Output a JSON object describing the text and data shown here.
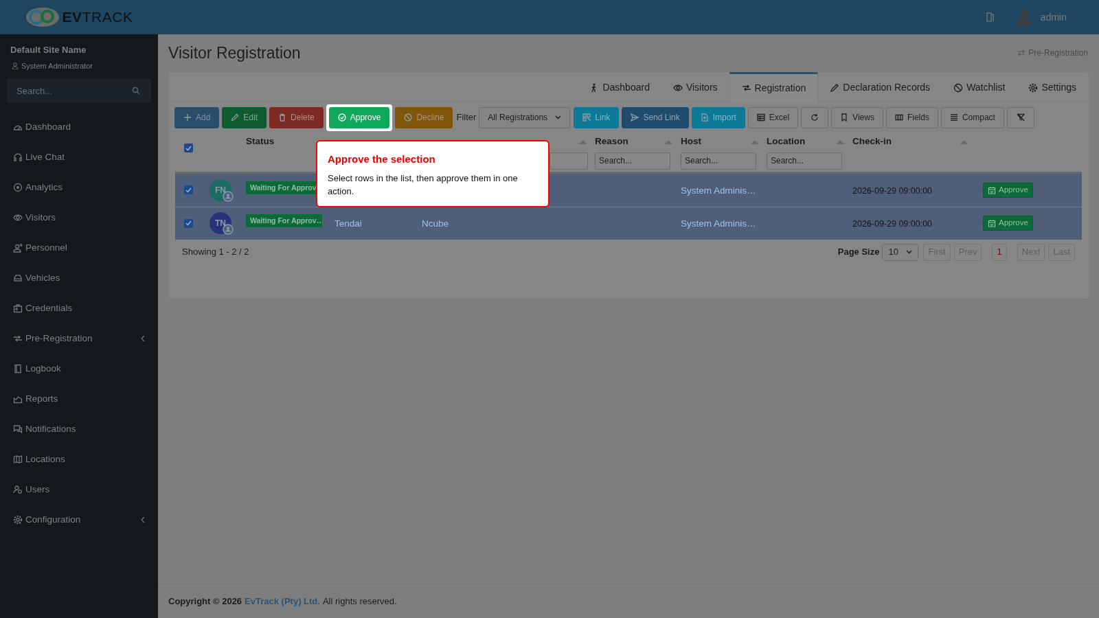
{
  "topbar": {
    "logo": "**EV**TRACK",
    "user": "admin"
  },
  "sidebar": {
    "site_name": "Default Site Name",
    "role": "System Administrator",
    "search": {
      "placeholder": "Search..."
    },
    "items": [
      {
        "label": "Dashboard",
        "has_submenu": false
      },
      {
        "label": "Live Chat",
        "has_submenu": false
      },
      {
        "label": "Analytics",
        "has_submenu": false
      },
      {
        "label": "Visitors",
        "has_submenu": false
      },
      {
        "label": "Personnel",
        "has_submenu": false
      },
      {
        "label": "Vehicles",
        "has_submenu": false
      },
      {
        "label": "Credentials",
        "has_submenu": false
      },
      {
        "label": "Pre-Registration",
        "has_submenu": true
      },
      {
        "label": "Logbook",
        "has_submenu": false
      },
      {
        "label": "Reports",
        "has_submenu": false
      },
      {
        "label": "Notifications",
        "has_submenu": false
      },
      {
        "label": "Locations",
        "has_submenu": false
      },
      {
        "label": "Users",
        "has_submenu": false
      },
      {
        "label": "Configuration",
        "has_submenu": true
      }
    ]
  },
  "page": {
    "title": "Visitor Registration",
    "breadcrumb": "Pre-Registration"
  },
  "tabs": [
    {
      "label": "Dashboard",
      "selected": false
    },
    {
      "label": "Visitors",
      "selected": false
    },
    {
      "label": "Registration",
      "selected": true
    },
    {
      "label": "Declaration Records",
      "selected": false
    },
    {
      "label": "Watchlist",
      "selected": false
    },
    {
      "label": "Settings",
      "selected": false
    }
  ],
  "toolbar": {
    "buttons": [
      {
        "label": "Add",
        "kind": "primary"
      },
      {
        "label": "Edit",
        "kind": "success"
      },
      {
        "label": "Delete",
        "kind": "danger"
      },
      {
        "label": "Approve",
        "kind": "highlight"
      },
      {
        "label": "Decline",
        "kind": "warning"
      }
    ],
    "filter": {
      "label": "Filter",
      "value": "All Registrations"
    },
    "buttons_right": [
      {
        "label": "Link",
        "kind": "info"
      },
      {
        "label": "Send Link",
        "kind": "dark"
      },
      {
        "label": "Import",
        "kind": "info"
      },
      {
        "label": "Excel",
        "kind": "outline"
      },
      {
        "kind": "outline"
      },
      {
        "label": "Views",
        "kind": "outline"
      },
      {
        "label": "Fields",
        "kind": "outline"
      },
      {
        "label": "Compact",
        "kind": "outline"
      },
      {
        "kind": "outline"
      }
    ]
  },
  "table": {
    "select_all": {
      "checked": true
    },
    "columns": [
      {
        "label": "Status"
      },
      {},
      {
        "sortable": true,
        "search": true
      },
      {
        "label": "Reason",
        "sortable": true,
        "search": {
          "placeholder": "Search..."
        }
      },
      {
        "label": "Host",
        "sortable": true,
        "search": {
          "placeholder": "Search..."
        }
      },
      {
        "label": "Location",
        "sortable": true,
        "search": {
          "placeholder": "Search..."
        }
      },
      {
        "label": "Check-in",
        "sortable": true
      }
    ],
    "rows": [
      {
        "checked": true,
        "initials": "FN",
        "color": "#1d6b62",
        "status": "Waiting For Approv",
        "host": "System Adminis…",
        "checkin": "2026-09-29 09:00:00",
        "action": "Approve"
      },
      {
        "checked": true,
        "initials": "TN",
        "color": "#28327a",
        "status": "Waiting For Approv…",
        "first_name": "Tendai",
        "last_name": "Ncube",
        "host": "System Adminis…",
        "checkin": "2026-09-29 09:00:00",
        "action": "Approve"
      }
    ]
  },
  "pagination": {
    "summary": "Showing 1 - 2 / 2",
    "page_size_label": "Page Size",
    "page_size": "10",
    "buttons": [
      {
        "label": "First",
        "selected": false
      },
      {
        "label": "Prev",
        "selected": false
      },
      {
        "label": "1",
        "selected": true
      },
      {
        "label": "Next",
        "selected": false
      },
      {
        "label": "Last",
        "selected": false
      }
    ]
  },
  "tooltip": {
    "title": "Approve the selection",
    "text": "Select rows in the list, then approve them in one action."
  },
  "footer": {
    "prefix": "Copyright © 2026",
    "link": "EvTrack (Pty) Ltd.",
    "suffix": "All rights reserved."
  }
}
